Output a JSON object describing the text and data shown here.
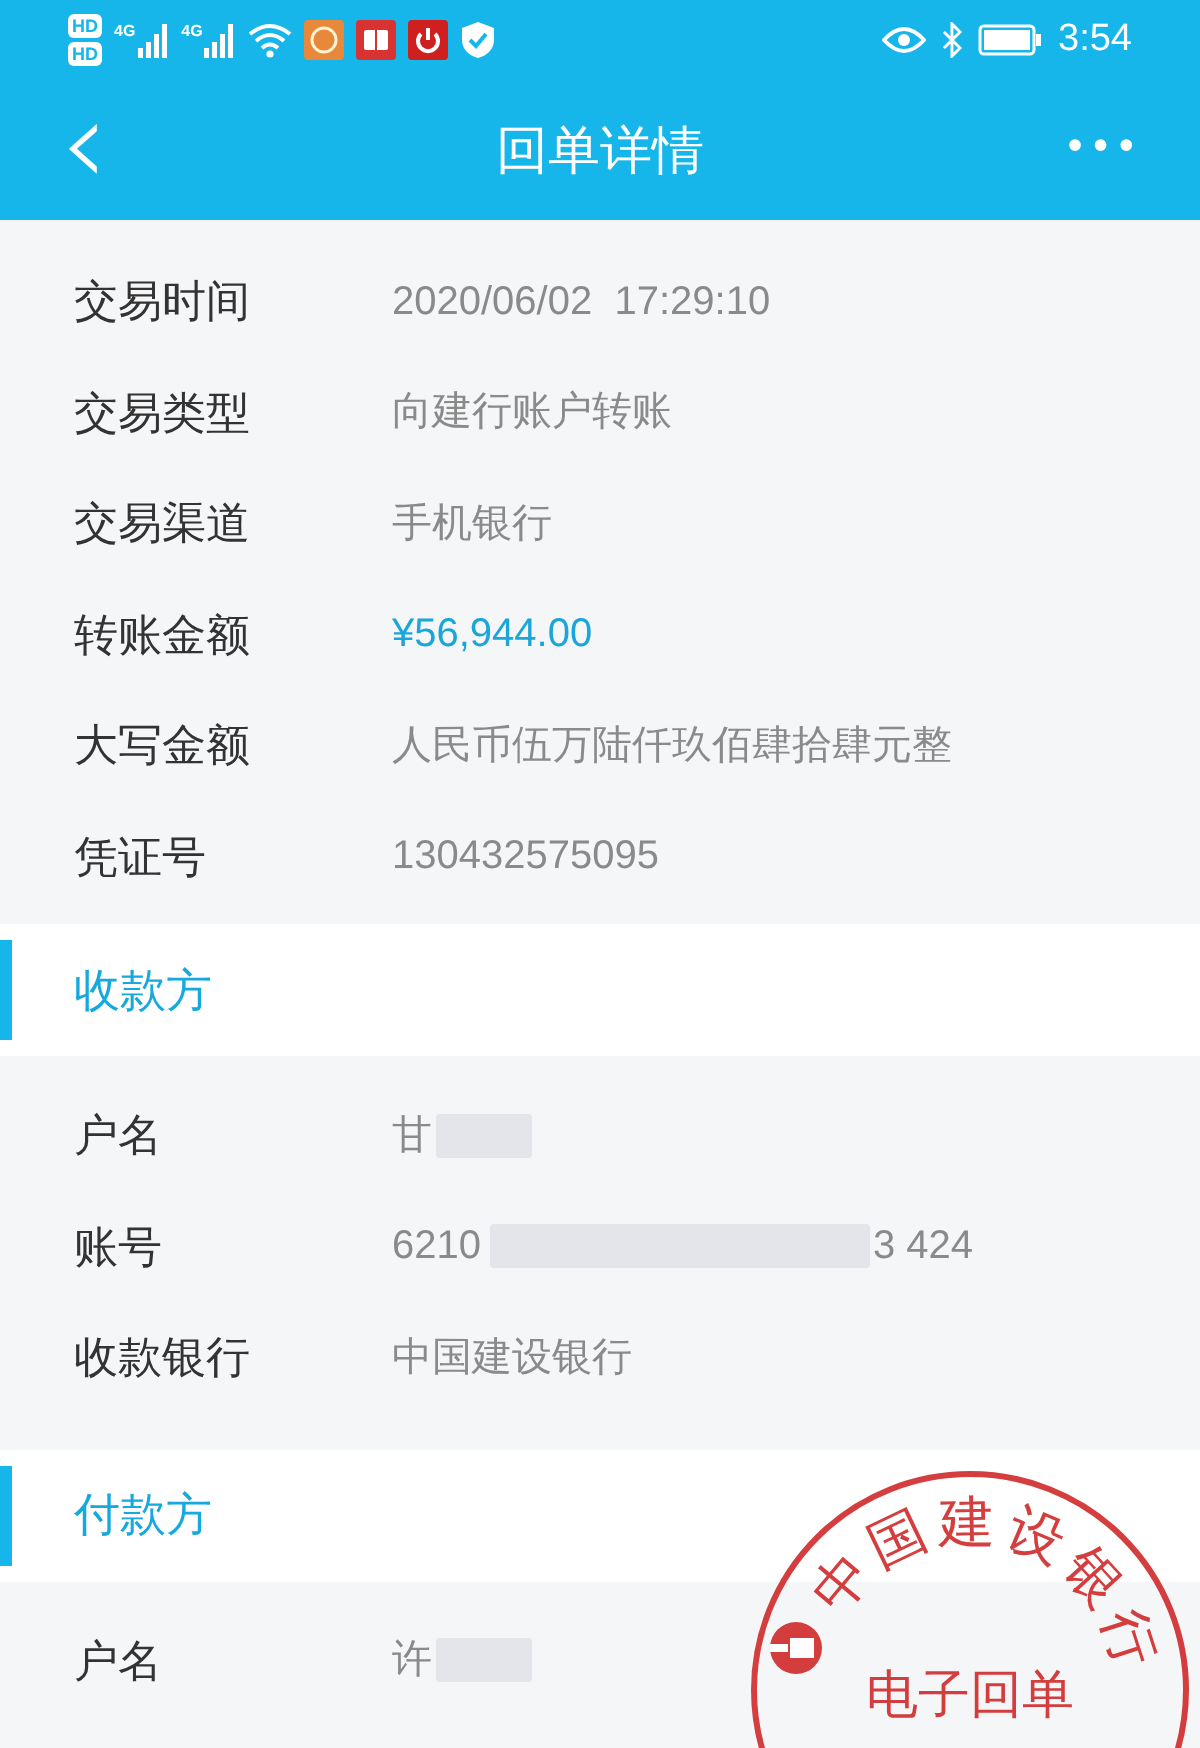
{
  "status_bar": {
    "sim_labels": [
      "HD",
      "HD"
    ],
    "network_labels": [
      "4G",
      "4G"
    ],
    "time": "3:54"
  },
  "nav": {
    "back": "‹",
    "title": "回单详情",
    "more": "•••"
  },
  "details": [
    {
      "label": "交易时间",
      "value": "2020/06/02  17:29:10",
      "kind": "text"
    },
    {
      "label": "交易类型",
      "value": "向建行账户转账",
      "kind": "text"
    },
    {
      "label": "交易渠道",
      "value": "手机银行",
      "kind": "text"
    },
    {
      "label": "转账金额",
      "value": "¥56,944.00",
      "kind": "amount"
    },
    {
      "label": "大写金额",
      "value": "人民币伍万陆仟玖佰肆拾肆元整",
      "kind": "text"
    },
    {
      "label": "凭证号",
      "value": "130432575095",
      "kind": "text"
    }
  ],
  "sections": [
    {
      "title": "收款方",
      "rows": [
        {
          "label": "户名",
          "value": "甘",
          "kind": "masked"
        },
        {
          "label": "账号",
          "value": "6210",
          "value_end": "3 424",
          "kind": "masked_middle"
        },
        {
          "label": "收款银行",
          "value": "中国建设银行",
          "kind": "text"
        }
      ]
    },
    {
      "title": "付款方",
      "rows": [
        {
          "label": "户名",
          "value": "许",
          "kind": "masked"
        }
      ]
    }
  ],
  "stamp": {
    "arc_text": "中国建设银行",
    "center_text": "电子回单"
  }
}
